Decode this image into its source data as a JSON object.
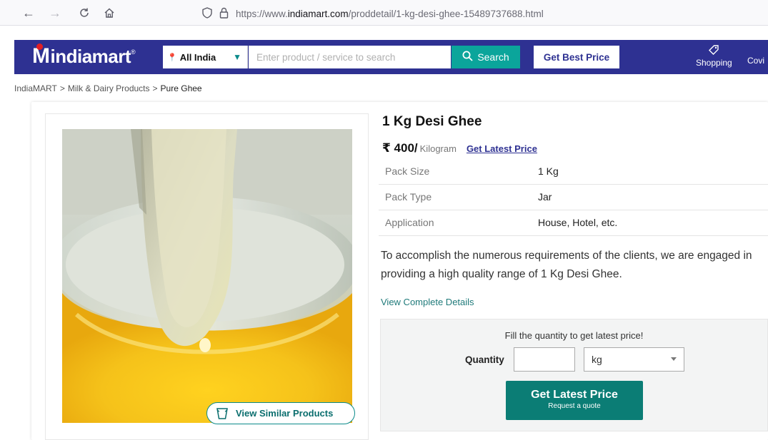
{
  "browser": {
    "url_prefix": "https://www.",
    "url_domain": "indiamart.com",
    "url_path": "/proddetail/1-kg-desi-ghee-15489737688.html"
  },
  "header": {
    "logo_text": "indiamart",
    "logo_mark": "®",
    "location": "All India",
    "search_placeholder": "Enter product / service to search",
    "search_label": "Search",
    "best_price_label": "Get Best Price",
    "shopping_label": "Shopping",
    "covid_label": "Covi"
  },
  "breadcrumb": [
    "IndiaMART",
    "Milk & Dairy Products",
    "Pure Ghee"
  ],
  "breadcrumb_sep": ">",
  "product": {
    "title": "1 Kg Desi Ghee",
    "price": "₹ 400/",
    "unit": "Kilogram",
    "get_latest_price_link": "Get Latest Price",
    "specs": [
      {
        "key": "Pack Size",
        "value": "1 Kg"
      },
      {
        "key": "Pack Type",
        "value": "Jar"
      },
      {
        "key": "Application",
        "value": "House, Hotel, etc."
      }
    ],
    "description": "To accomplish the numerous requirements of the clients, we are engaged in providing a high quality range of 1 Kg Desi Ghee.",
    "view_details": "View Complete Details",
    "similar_label": "View Similar Products"
  },
  "quote": {
    "hint": "Fill the quantity to get latest price!",
    "quantity_label": "Quantity",
    "quantity_value": "",
    "unit_selected": "kg",
    "button_main": "Get Latest Price",
    "button_sub": "Request a quote"
  },
  "colors": {
    "header_bg": "#2e3192",
    "accent_teal": "#0ba59b",
    "button_green": "#0b7d75"
  }
}
